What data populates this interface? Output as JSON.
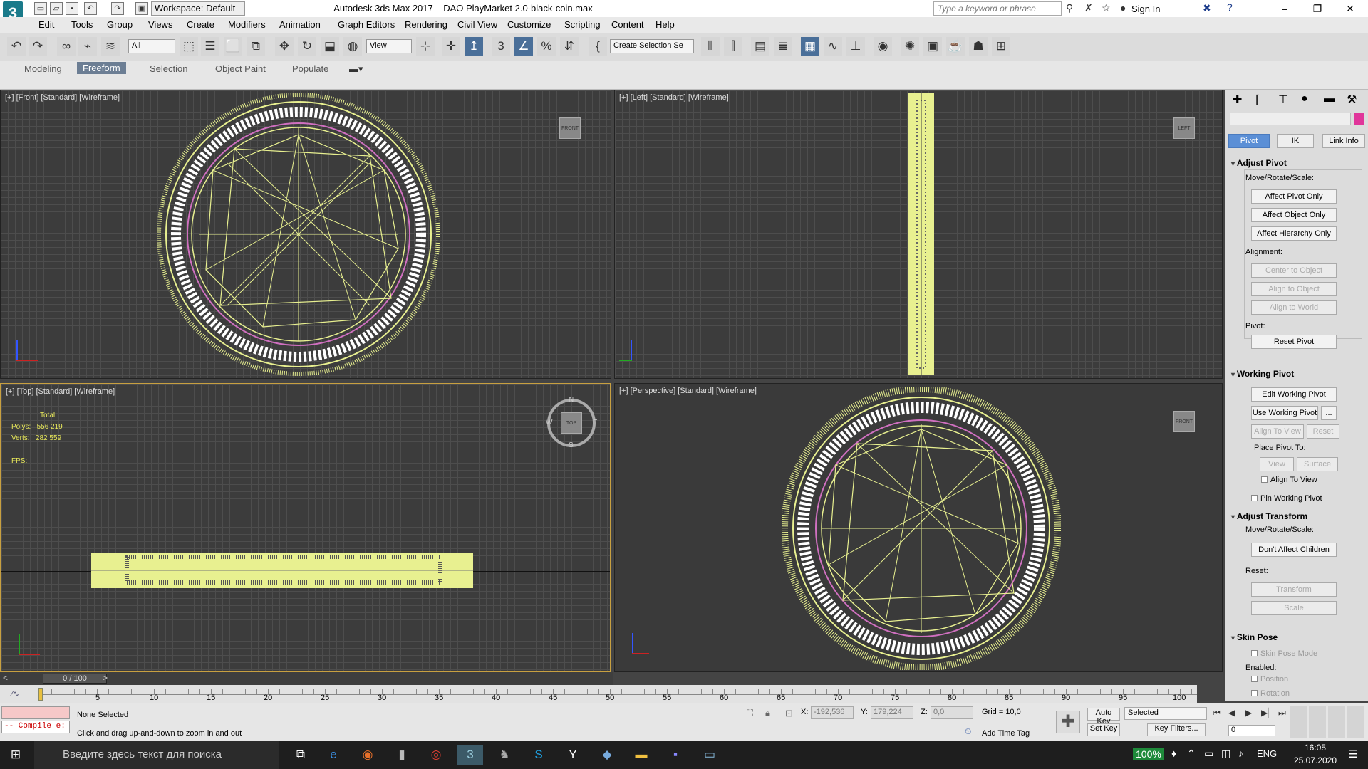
{
  "titlebar": {
    "app": "Autodesk 3ds Max 2017",
    "file": "DAO PlayMarket 2.0-black-coin.max",
    "logo": "3",
    "workspace": "Workspace: Default",
    "search_placeholder": "Type a keyword or phrase",
    "signin": "Sign In"
  },
  "menu": [
    "Edit",
    "Tools",
    "Group",
    "Views",
    "Create",
    "Modifiers",
    "Animation",
    "Graph Editors",
    "Rendering",
    "Civil View",
    "Customize",
    "Scripting",
    "Content",
    "Help"
  ],
  "toolbar": {
    "filter": "All",
    "refcoord": "View",
    "selection_set": "Create Selection Se"
  },
  "ribbon": {
    "tabs": [
      "Modeling",
      "Freeform",
      "Selection",
      "Object Paint",
      "Populate"
    ],
    "active": "Freeform"
  },
  "viewports": {
    "front": {
      "label": "[+] [Front] [Standard] [Wireframe]",
      "cube": "FRONT"
    },
    "left": {
      "label": "[+] [Left] [Standard] [Wireframe]",
      "cube": "LEFT"
    },
    "top": {
      "label": "[+] [Top] [Standard] [Wireframe]",
      "cube": "TOP"
    },
    "persp": {
      "label": "[+] [Perspective] [Standard] [Wireframe]",
      "cube": "FRONT"
    }
  },
  "stats": {
    "total": "Total",
    "polys_label": "Polys:",
    "polys": "556 219",
    "verts_label": "Verts:",
    "verts": "282 559",
    "fps_label": "FPS:"
  },
  "compass": {
    "n": "N",
    "s": "S",
    "e": "E",
    "w": "W"
  },
  "cmdpanel": {
    "tabs": [
      "Pivot",
      "IK",
      "Link Info"
    ],
    "adjust_pivot": "Adjust Pivot",
    "move_rot_scale": "Move/Rotate/Scale:",
    "affect_pivot": "Affect Pivot Only",
    "affect_object": "Affect Object Only",
    "affect_hierarchy": "Affect Hierarchy Only",
    "alignment": "Alignment:",
    "center_to_object": "Center to Object",
    "align_to_object": "Align to Object",
    "align_to_world": "Align to World",
    "pivot": "Pivot:",
    "reset_pivot": "Reset Pivot",
    "working_pivot": "Working Pivot",
    "edit_working_pivot": "Edit Working Pivot",
    "use_working_pivot": "Use Working Pivot",
    "more": "...",
    "align_to_view": "Align To View",
    "reset": "Reset",
    "place_pivot_to": "Place Pivot To:",
    "view": "View",
    "surface": "Surface",
    "align_to_view_chk": "Align To View",
    "pin_working_pivot": "Pin Working Pivot",
    "adjust_transform": "Adjust Transform",
    "move_rot_scale2": "Move/Rotate/Scale:",
    "dont_affect_children": "Don't Affect Children",
    "reset2": "Reset:",
    "transform": "Transform",
    "scale": "Scale",
    "skin_pose": "Skin Pose",
    "skin_pose_mode": "Skin Pose Mode",
    "enabled": "Enabled:",
    "position": "Position",
    "rotation": "Rotation"
  },
  "timeslider": {
    "value": "0 / 100",
    "prev": "<",
    "next": ">"
  },
  "trackbar": {
    "ticks": [
      "5",
      "10",
      "15",
      "20",
      "25",
      "30",
      "35",
      "40",
      "45",
      "50",
      "55",
      "60",
      "65",
      "70",
      "75",
      "80",
      "85",
      "90",
      "95",
      "100"
    ]
  },
  "status": {
    "listener": "-- Compile e:",
    "selection": "None Selected",
    "prompt": "Click and drag up-and-down to zoom in and out",
    "x_label": "X:",
    "x": "-192,536",
    "y_label": "Y:",
    "y": "179,224",
    "z_label": "Z:",
    "z": "0,0",
    "grid": "Grid = 10,0",
    "add_time_tag": "Add Time Tag",
    "auto_key": "Auto Key",
    "set_key": "Set Key",
    "key_mode": "Selected",
    "key_filters": "Key Filters...",
    "frame": "0"
  },
  "taskbar": {
    "search": "Введите здесь текст для поиска",
    "battery": "100%",
    "lang": "ENG",
    "time": "16:05",
    "date": "25.07.2020"
  },
  "colors": {
    "wire_yellow": "#e8f090",
    "wire_pink": "#d070c0",
    "active_border": "#c8a040",
    "accent": "#5b8fd6"
  }
}
